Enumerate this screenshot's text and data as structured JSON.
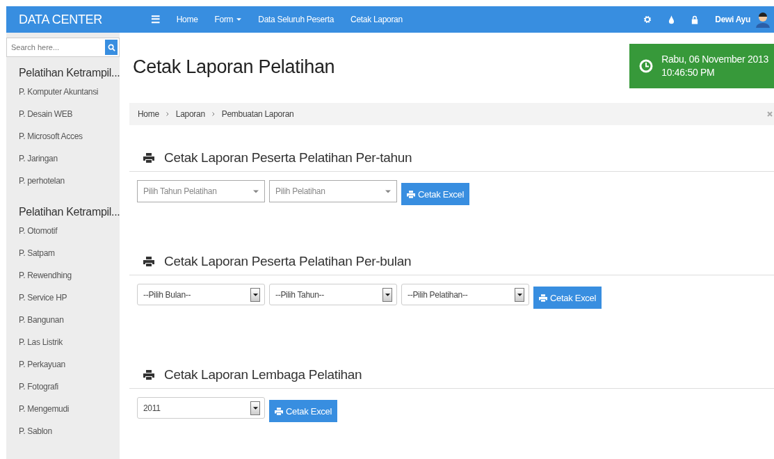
{
  "navbar": {
    "brand": "DATA CENTER",
    "menu_icon": "☰",
    "links": [
      {
        "label": "Home",
        "dropdown": false
      },
      {
        "label": "Form",
        "dropdown": true
      },
      {
        "label": "Data Seluruh Peserta",
        "dropdown": false
      },
      {
        "label": "Cetak Laporan",
        "dropdown": false
      }
    ],
    "user": "Dewi Ayu"
  },
  "sidebar": {
    "search": {
      "placeholder": "Search here..."
    },
    "groups": [
      {
        "title": "Pelatihan Ketrampil...",
        "items": [
          "P. Komputer Akuntansi",
          "P. Desain WEB",
          "P. Microsoft Acces",
          "P. Jaringan",
          "P. perhotelan"
        ]
      },
      {
        "title": "Pelatihan Ketrampil...",
        "items": [
          "P. Otomotif",
          "P. Satpam",
          "P. Rewendhing",
          "P. Service HP",
          "P. Bangunan",
          "P. Las Listrik",
          "P. Perkayuan",
          "P. Fotografi",
          "P. Mengemudi",
          "P. Sablon"
        ]
      }
    ]
  },
  "page_title": "Cetak Laporan Pelatihan",
  "clock": {
    "date": "Rabu, 06 November 2013",
    "time": "10:46:50 PM"
  },
  "breadcrumb": [
    "Home",
    "Laporan",
    "Pembuatan Laporan"
  ],
  "sections": [
    {
      "title": "Cetak Laporan Peserta Pelatihan Per-tahun",
      "selects": [
        {
          "kind": "chosen",
          "placeholder": "Pilih Tahun Pelatihan"
        },
        {
          "kind": "chosen",
          "placeholder": "Pilih Pelatihan"
        }
      ],
      "button": "Cetak Excel"
    },
    {
      "title": "Cetak Laporan Peserta Pelatihan Per-bulan",
      "selects": [
        {
          "kind": "native",
          "value": "--Pilih Bulan--"
        },
        {
          "kind": "native",
          "value": "--Pilih Tahun--"
        },
        {
          "kind": "native",
          "value": "--Pilih Pelatihan--"
        }
      ],
      "button": "Cetak Excel"
    },
    {
      "title": "Cetak Laporan Lembaga Pelatihan",
      "selects": [
        {
          "kind": "native",
          "value": "2011"
        }
      ],
      "button": "Cetak Excel"
    }
  ]
}
